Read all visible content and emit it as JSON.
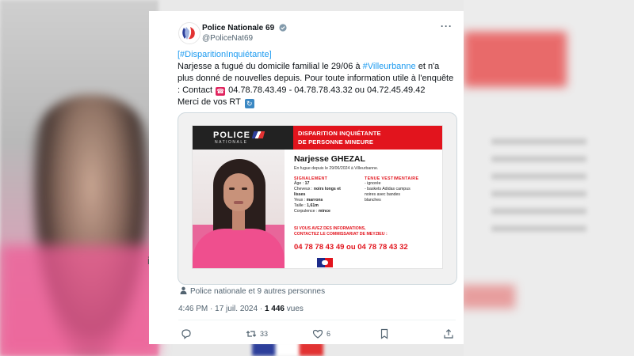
{
  "tweet": {
    "author_name": "Police Nationale 69",
    "handle": "@PoliceNat69",
    "text": {
      "hashtag1": "[#DisparitionInquiétante]",
      "line2_start": "Narjesse a fugué du domicile familial le 29/06 à ",
      "hashtag2": "#Villeurbanne",
      "line2_end": " et n'a plus donné de nouvelles depuis.  Pour toute information utile à l'enquête : Contact ",
      "phones": " 04.78.78.43.49 - 04.78.78.43.32 ou 04.72.45.49.42",
      "closing": "Merci de vos RT "
    },
    "tagged": "Police nationale et 9 autres personnes",
    "time": "4:46 PM · 17 juil. 2024 · ",
    "views_count": "1 446",
    "views_label": " vues",
    "retweets": "33",
    "likes": "6"
  },
  "poster": {
    "logo_police": "POLICE",
    "logo_nationale": "NATIONALE",
    "header_line1": "DISPARITION INQUIÉTANTE",
    "header_line2": "DE PERSONNE MINEURE",
    "name": "Narjesse GHEZAL",
    "fugue": "En fugue depuis le 29/06/2024 à Villeurbanne.",
    "signalement_title": "SIGNALEMENT",
    "age_label": "Âge : ",
    "age": "17",
    "cheveux_label": "Cheveux : ",
    "cheveux": "noirs longs et",
    "cheveux2": "lisses",
    "yeux_label": "Yeux : ",
    "yeux": "marrons",
    "taille_label": "Taille : ",
    "taille": "1,61m",
    "corpulence_label": "Corpulence : ",
    "corpulence": "mince",
    "tenue_title": "TENUE VESTIMENTAIRE",
    "tenue1": "- ignorée",
    "tenue2": "- baskets Adidas campus",
    "tenue3": "noires avec bandes",
    "tenue4": "blanches",
    "cta1": "SI VOUS AVEZ DES INFORMATIONS,",
    "cta2": "CONTACTEZ LE COMMISSARIAT DE MEYZIEU :",
    "phone": "04 78 78 43 49 ou 04 78 78 43 32"
  },
  "background": {
    "fragment": "i"
  },
  "colors": {
    "link": "#1d9bf0",
    "alert_red": "#e2141d",
    "muted": "#536471"
  },
  "icons": [
    "more-icon",
    "verified-icon",
    "person-icon",
    "reply-icon",
    "retweet-icon",
    "like-icon",
    "bookmark-icon",
    "share-icon",
    "telephone-emoji",
    "repeat-emoji"
  ]
}
